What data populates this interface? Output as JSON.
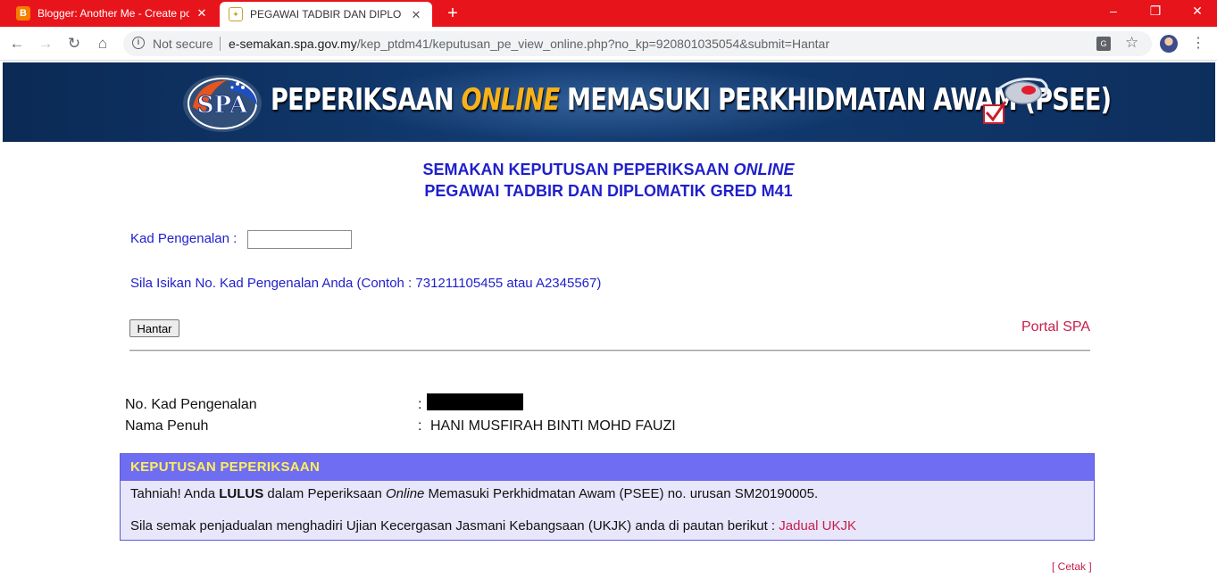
{
  "browser": {
    "tabs": [
      {
        "title": "Blogger: Another Me - Create po",
        "favicon": "blogger-icon"
      },
      {
        "title": "PEGAWAI TADBIR DAN DIPLOMA",
        "favicon": "spa-crest-icon"
      }
    ],
    "new_tab": "+",
    "window_controls": {
      "minimize": "–",
      "restore": "❐",
      "close": "✕"
    },
    "nav": {
      "back": "←",
      "forward": "→",
      "reload": "↻",
      "home": "⌂"
    },
    "security_label": "Not secure",
    "url_host": "e-semakan.spa.gov.my",
    "url_path": "/kep_ptdm41/keputusan_pe_view_online.php?no_kp=920801035054&submit=Hantar",
    "star": "☆",
    "menu": "⋮",
    "accent_color": "#e8141c"
  },
  "banner": {
    "title_start": "PEPERIKSAAN ",
    "title_online": "ONLINE",
    "title_end": " MEMASUKI PERKHIDMATAN AWAM (PSEE)",
    "logo_text": "SPA"
  },
  "heading": {
    "line1_start": "SEMAKAN KEPUTUSAN PEPERIKSAAN ",
    "line1_online": "ONLINE",
    "line2": "PEGAWAI TADBIR DAN DIPLOMATIK GRED M41"
  },
  "form": {
    "kp_label": "Kad Pengenalan :",
    "kp_value": "",
    "hint": "Sila Isikan No. Kad Pengenalan Anda (Contoh : 731211105455 atau A2345567)",
    "submit_label": "Hantar",
    "portal_link": "Portal SPA"
  },
  "candidate": {
    "ic_label": "No. Kad Pengenalan",
    "name_label": "Nama Penuh",
    "colon": ":",
    "name_value": "HANI MUSFIRAH BINTI MOHD FAUZI"
  },
  "result": {
    "header": "KEPUTUSAN PEPERIKSAAN",
    "line1_a": "Tahniah! Anda ",
    "line1_status": "LULUS",
    "line1_b": " dalam Peperiksaan ",
    "line1_online": "Online",
    "line1_c": " Memasuki Perkhidmatan Awam (PSEE) no. urusan SM20190005.",
    "line2_text": "Sila semak penjadualan menghadiri Ujian Kecergasan Jasmani Kebangsaan (UKJK) anda di pautan berikut : ",
    "line2_link": "Jadual UKJK",
    "colors": {
      "header_bg": "#6f6df2",
      "header_text": "#ffef5c",
      "body_bg": "#e8e6fb",
      "link": "#c81e4a"
    }
  },
  "footer": {
    "print_open": "[ ",
    "print_label": "Cetak",
    "print_close": " ]"
  }
}
